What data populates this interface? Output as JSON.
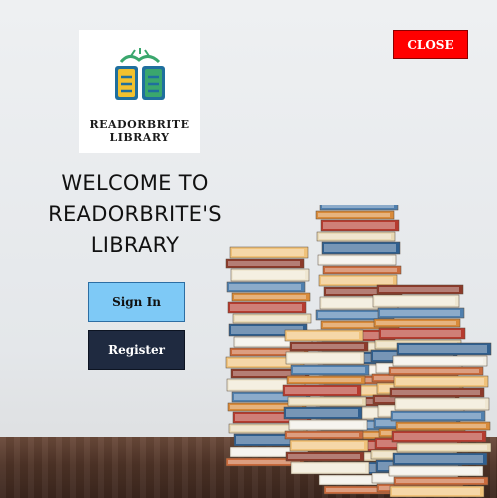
{
  "logo": {
    "line1": "READORBRITE",
    "line2": "LIBRARY",
    "colors": {
      "blue": "#1f6f9e",
      "yellow": "#f2c12e",
      "green": "#3aa76d"
    }
  },
  "close_button": {
    "label": "CLOSE",
    "color": "#ff0000"
  },
  "welcome": {
    "line1": "WELCOME TO",
    "line2": "READORBRITE'S",
    "line3": "LIBRARY"
  },
  "buttons": {
    "sign_in": "Sign In",
    "register": "Register"
  }
}
